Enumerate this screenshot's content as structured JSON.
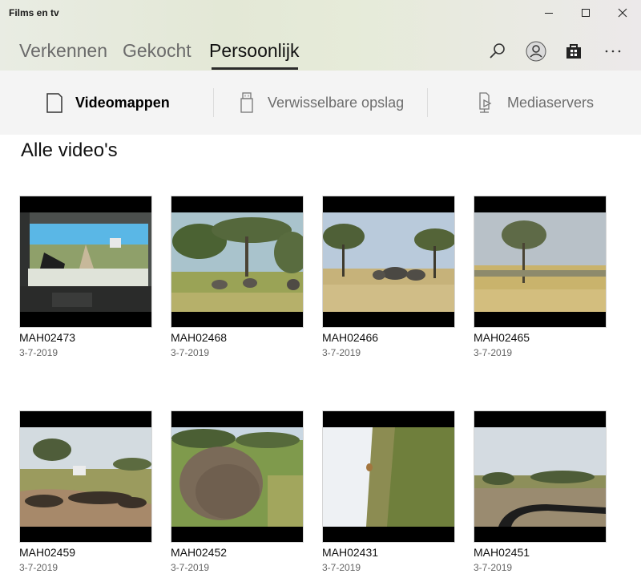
{
  "window": {
    "title": "Films en tv"
  },
  "nav": {
    "tabs": [
      {
        "label": "Verkennen"
      },
      {
        "label": "Gekocht"
      },
      {
        "label": "Persoonlijk"
      }
    ],
    "active_tab": "Persoonlijk"
  },
  "header_icons": [
    "search-icon",
    "account-icon",
    "store-icon",
    "more-icon"
  ],
  "subnav": {
    "items": [
      {
        "label": "Videomappen",
        "icon": "phone-icon"
      },
      {
        "label": "Verwisselbare opslag",
        "icon": "usb-icon"
      },
      {
        "label": "Mediaservers",
        "icon": "media-server-icon"
      }
    ],
    "active_item": "Videomappen"
  },
  "section": {
    "title": "Alle video's"
  },
  "videos": [
    {
      "name": "MAH02473",
      "date": "3-7-2019"
    },
    {
      "name": "MAH02468",
      "date": "3-7-2019"
    },
    {
      "name": "MAH02466",
      "date": "3-7-2019"
    },
    {
      "name": "MAH02465",
      "date": "3-7-2019"
    },
    {
      "name": "MAH02459",
      "date": "3-7-2019"
    },
    {
      "name": "MAH02452",
      "date": "3-7-2019"
    },
    {
      "name": "MAH02431",
      "date": "3-7-2019"
    },
    {
      "name": "MAH02451",
      "date": "3-7-2019"
    }
  ]
}
